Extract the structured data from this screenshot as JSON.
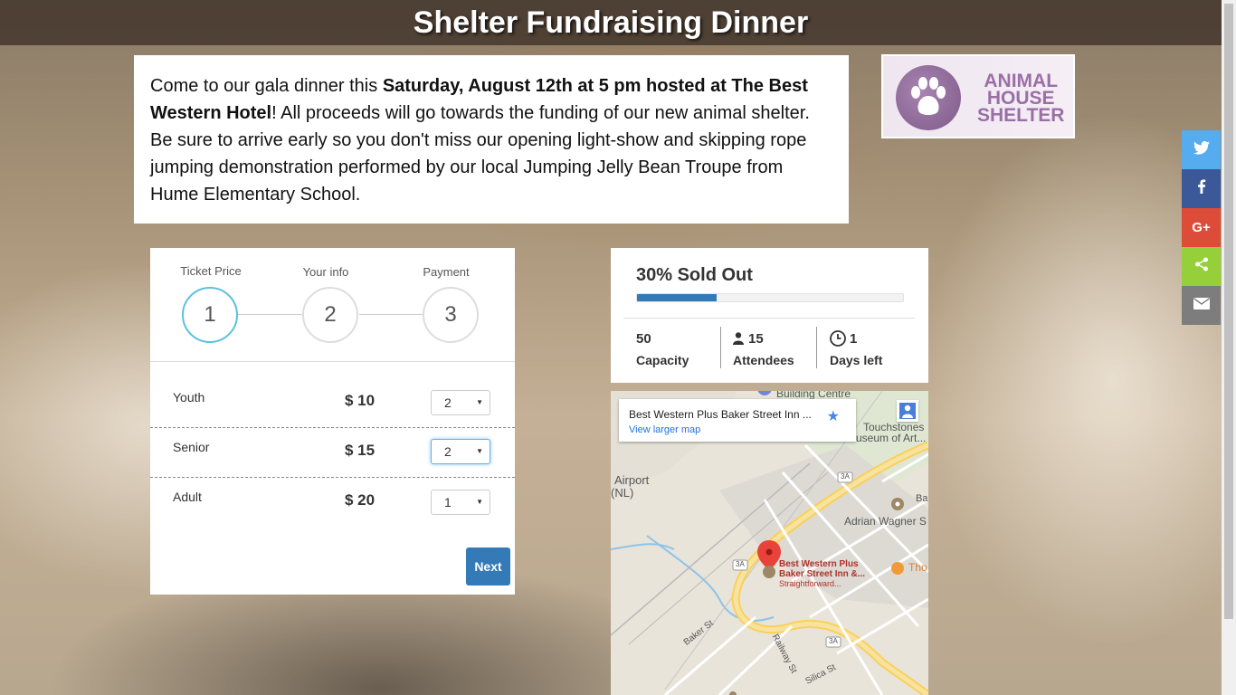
{
  "header": {
    "title": "Shelter Fundraising Dinner"
  },
  "intro": {
    "t1": "Come to our gala dinner this ",
    "b1": "Saturday, August 12th at 5 pm hosted at The Best Western Hotel",
    "t2": "! All proceeds will go towards the funding of our new animal shelter.  Be sure to arrive early so you don't miss our opening light-show and skipping rope jumping demonstration performed by our local  Jumping Jelly Bean Troupe from Hume Elementary School."
  },
  "logo": {
    "line1": "ANIMAL",
    "line2": "HOUSE",
    "line3": "SHELTER"
  },
  "wizard": {
    "steps": [
      {
        "label": "Ticket Price",
        "number": "1"
      },
      {
        "label": "Your info",
        "number": "2"
      },
      {
        "label": "Payment",
        "number": "3"
      }
    ],
    "active_step": 1,
    "tickets": [
      {
        "name": "Youth",
        "price": "$ 10",
        "qty": "2"
      },
      {
        "name": "Senior",
        "price": "$ 15",
        "qty": "2"
      },
      {
        "name": "Adult",
        "price": "$ 20",
        "qty": "1"
      }
    ],
    "next_label": "Next"
  },
  "stats": {
    "sold_out": "30% Sold Out",
    "sold_fraction": 0.3,
    "capacity_value": "50",
    "capacity_label": "Capacity",
    "attendees_value": "15",
    "attendees_label": "Attendees",
    "days_value": "1",
    "days_label": "Days left"
  },
  "map": {
    "place_name": "Best Western Plus Baker Street Inn ...",
    "view_larger": "View larger map",
    "labels": {
      "building": "Building Centre",
      "touchstones": "Touchstones",
      "museum": "useum of Art...",
      "airport1": "Airport",
      "airport2": "(NL)",
      "adrian": "Adrian Wagner S",
      "ba": "Ba",
      "bw1": "Best Western Plus",
      "bw2": "Baker Street Inn &...",
      "bw3": "Straightforward...",
      "tho": "Tho",
      "baker": "Baker St",
      "railway": "Railway St",
      "silica": "Silica St",
      "hw1": "3A",
      "hw2": "3A",
      "hw3": "3A"
    }
  },
  "social": [
    {
      "icon": "twitter-icon",
      "color": "#55acee"
    },
    {
      "icon": "facebook-icon",
      "color": "#3b5998"
    },
    {
      "icon": "google-plus-icon",
      "color": "#dd4b39"
    },
    {
      "icon": "share-icon",
      "color": "#95d03a"
    },
    {
      "icon": "email-icon",
      "color": "#7d7d7d"
    }
  ]
}
